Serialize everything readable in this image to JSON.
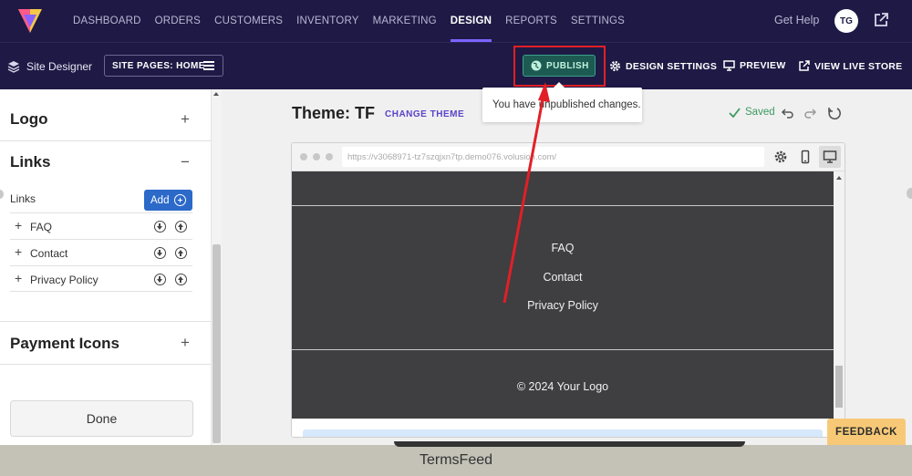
{
  "nav": {
    "items": [
      {
        "label": "DASHBOARD",
        "active": false
      },
      {
        "label": "ORDERS",
        "active": false
      },
      {
        "label": "CUSTOMERS",
        "active": false
      },
      {
        "label": "INVENTORY",
        "active": false
      },
      {
        "label": "MARKETING",
        "active": false
      },
      {
        "label": "DESIGN",
        "active": true
      },
      {
        "label": "REPORTS",
        "active": false
      },
      {
        "label": "SETTINGS",
        "active": false
      }
    ],
    "get_help": "Get Help",
    "avatar_initials": "TG"
  },
  "subbar": {
    "site_designer": "Site Designer",
    "site_pages": "SITE PAGES: HOME",
    "publish": "PUBLISH",
    "design_settings": "DESIGN SETTINGS",
    "preview": "PREVIEW",
    "view_live_store": "VIEW LIVE STORE"
  },
  "tooltip": "You have unpublished changes.",
  "sidebar": {
    "logo": "Logo",
    "links": "Links",
    "links_sub": "Links",
    "add": "Add",
    "link_items": [
      "FAQ",
      "Contact",
      "Privacy Policy"
    ],
    "payment_icons": "Payment Icons",
    "done": "Done"
  },
  "main": {
    "theme_title": "Theme: TF",
    "change_theme": "CHANGE THEME",
    "saved": "Saved",
    "url": "https://v3068971-tz7szqjxn7tp.demo076.volusion.com/"
  },
  "preview": {
    "links": [
      "FAQ",
      "Contact",
      "Privacy Policy"
    ],
    "copyright": "© 2024 Your Logo"
  },
  "feedback": "FEEDBACK",
  "watermark": "TermsFeed",
  "colors": {
    "nav_bg": "#1e1a45",
    "accent": "#7b63ff",
    "publish_bg": "#1d5a52",
    "highlight": "#e21f26",
    "add_button": "#2c6ac9",
    "preview_bg": "#3f3e41",
    "feedback": "#f7c977"
  }
}
